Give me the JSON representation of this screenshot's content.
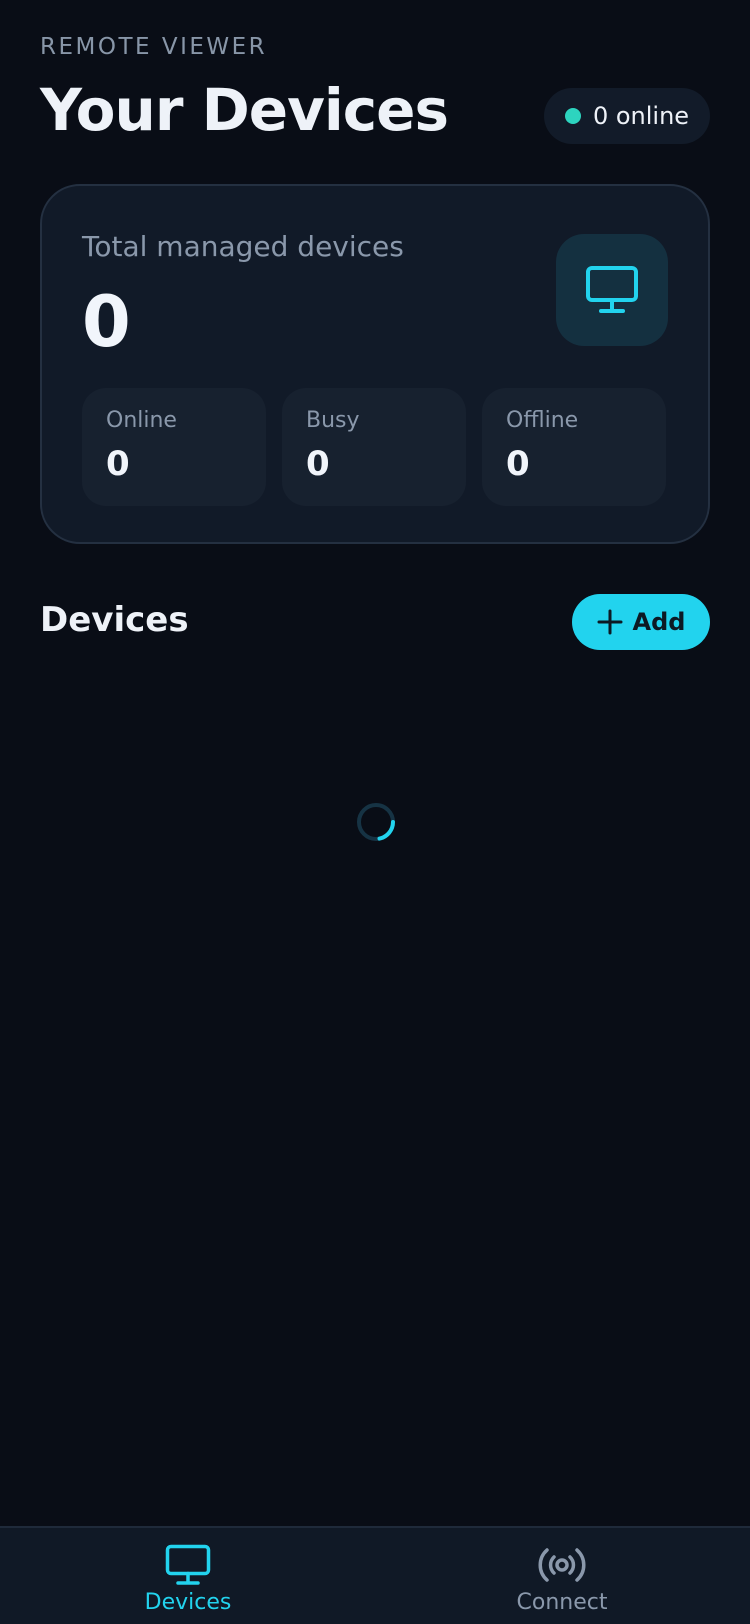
{
  "header": {
    "app_label": "REMOTE VIEWER",
    "title": "Your Devices",
    "online_status": "0 online"
  },
  "summary": {
    "label": "Total managed devices",
    "total": "0",
    "stats": [
      {
        "label": "Online",
        "value": "0"
      },
      {
        "label": "Busy",
        "value": "0"
      },
      {
        "label": "Offline",
        "value": "0"
      }
    ]
  },
  "devices_section": {
    "title": "Devices",
    "add_label": "Add",
    "loading": true
  },
  "bottom_nav": {
    "items": [
      {
        "label": "Devices",
        "icon": "monitor-icon",
        "active": true
      },
      {
        "label": "Connect",
        "icon": "broadcast-icon",
        "active": false
      }
    ]
  },
  "colors": {
    "background": "#090d16",
    "accent": "#22d3ee",
    "online": "#2dd4bf",
    "muted_text": "#8a98ab"
  }
}
